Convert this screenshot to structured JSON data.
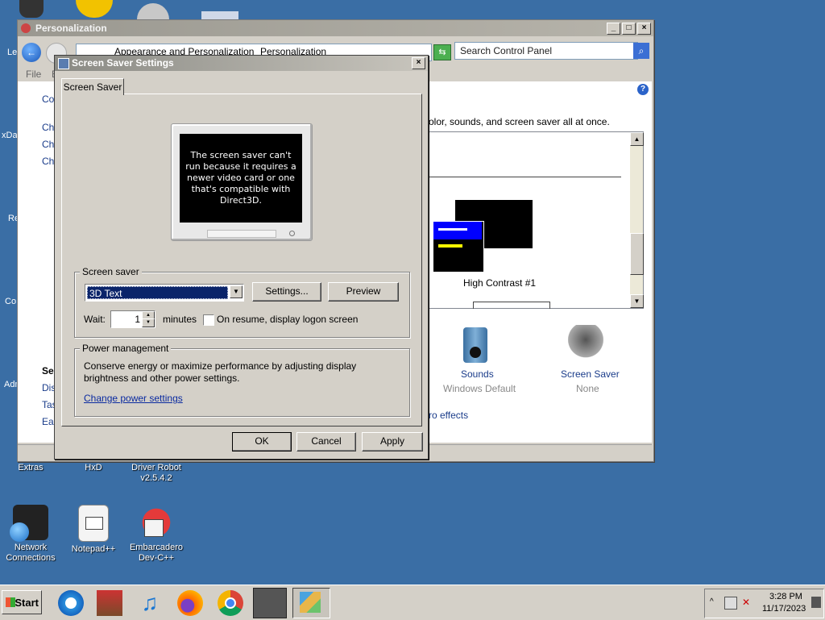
{
  "desktop": {
    "icons": [
      {
        "label": "Extras"
      },
      {
        "label": "HxD"
      },
      {
        "label": "Driver Robot v2.5.4.2"
      },
      {
        "label": "Network Connections"
      },
      {
        "label": "Notepad++"
      },
      {
        "label": "Embarcadero Dev-C++"
      }
    ],
    "left_fragments": [
      "Le",
      "xDa",
      "Re",
      "Co",
      "Adm"
    ]
  },
  "personalization_window": {
    "title": "Personalization",
    "breadcrumb": [
      "Appearance and Personalization",
      "Personalization"
    ],
    "search_placeholder": "Search Control Panel",
    "menu": [
      "File",
      "E"
    ],
    "sidebar_partial": [
      "Co",
      "Ch",
      "Ch",
      "Ch"
    ],
    "see_also_partial": [
      "Se",
      "Dis",
      "Tas",
      "Eas"
    ],
    "intro_text": "olor, sounds, and screen saver all at once.",
    "theme_name": "High Contrast #1",
    "sounds": {
      "label": "Sounds",
      "value": "Windows Default"
    },
    "screen_saver": {
      "label": "Screen Saver",
      "value": "None"
    },
    "effects_partial": "ro effects"
  },
  "dialog": {
    "title": "Screen Saver Settings",
    "tab": "Screen Saver",
    "preview_message": "The screen saver can't run because it requires a newer video card or one that's compatible with Direct3D.",
    "screen_saver_group": "Screen saver",
    "selected_saver": "3D Text",
    "settings_button": "Settings...",
    "preview_button": "Preview",
    "wait_label": "Wait:",
    "wait_value": "1",
    "minutes_label": "minutes",
    "resume_label": "On resume, display logon screen",
    "resume_checked": false,
    "power_group": "Power management",
    "power_text": "Conserve energy or maximize performance by adjusting display brightness and other power settings.",
    "power_link": "Change power settings",
    "ok": "OK",
    "cancel": "Cancel",
    "apply": "Apply"
  },
  "taskbar": {
    "start_label": "Start",
    "time": "3:28 PM",
    "date": "11/17/2023"
  },
  "colors": {
    "desktop": "#3a6ea5",
    "selection": "#0a246a",
    "link": "#0a2aa0"
  }
}
